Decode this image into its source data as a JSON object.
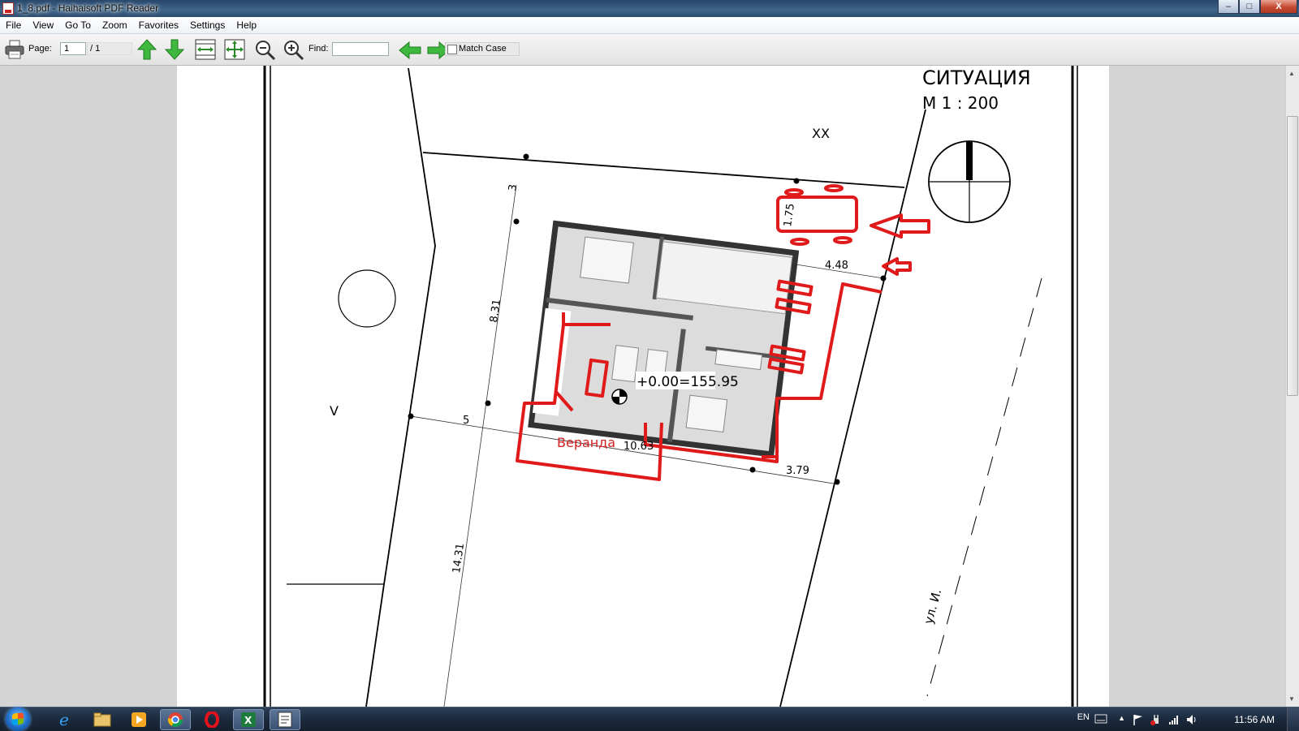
{
  "window": {
    "title": "1_8.pdf - Haihaisoft PDF Reader",
    "buttons": {
      "minimize": "–",
      "maximize": "□",
      "close": "X"
    }
  },
  "menu": [
    "File",
    "View",
    "Go To",
    "Zoom",
    "Favorites",
    "Settings",
    "Help"
  ],
  "toolbar": {
    "page_label": "Page:",
    "page_value": "1",
    "page_total": "/ 1",
    "find_label": "Find:",
    "find_value": "",
    "match_case_label": "Match Case"
  },
  "drawing": {
    "title": "СИТУАЦИЯ",
    "scale": "М 1 : 200",
    "street_xx": "XX",
    "plot_v": "V",
    "street_name": "ул. И.",
    "elevation": "+0.00=155.95",
    "veranda": "Веранда",
    "dims": {
      "d3": "3",
      "d831": "8.31",
      "d75": "1.75",
      "d448": "4.48",
      "d5": "5",
      "d1063": "10.63",
      "d379": "3.79",
      "d1431": "14.31"
    }
  },
  "taskbar": {
    "lang": "EN",
    "clock": "11:56 AM"
  },
  "colors": {
    "markup_red": "#e01a1a",
    "title_blue": "#2c4a6c"
  }
}
